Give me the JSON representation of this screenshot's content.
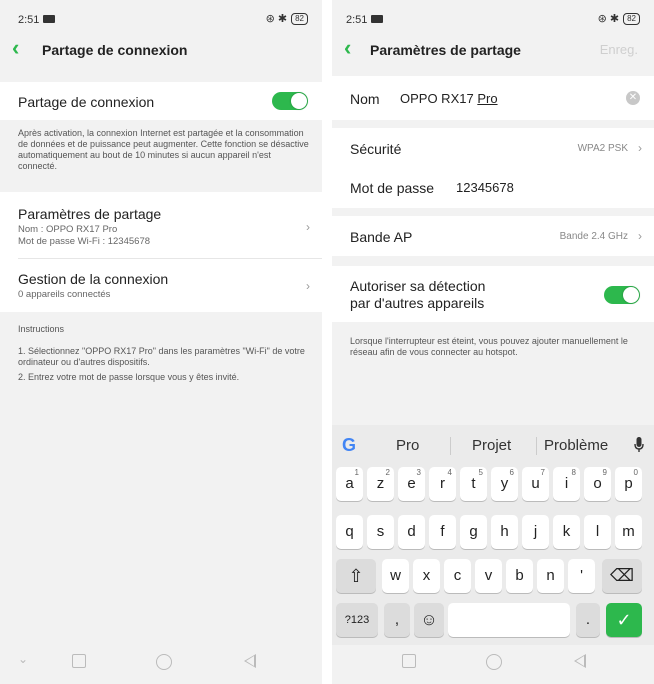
{
  "left": {
    "status": {
      "time": "2:51",
      "battery": "82",
      "icons": "⊛ ✱"
    },
    "title": "Partage de connexion",
    "hotspot": {
      "label": "Partage de connexion",
      "enabled": true
    },
    "hotspot_note": "Après activation, la connexion Internet est partagée et la consommation de données et de puissance peut augmenter. Cette fonction se désactive automatiquement au bout de 10 minutes si aucun appareil n'est connecté.",
    "settings": {
      "label": "Paramètres de partage",
      "sub1": "Nom : OPPO RX17 Pro",
      "sub2": "Mot de passe Wi-Fi : 12345678"
    },
    "connections": {
      "label": "Gestion de la connexion",
      "sub": "0 appareils connectés"
    },
    "instructions": {
      "heading": "Instructions",
      "step1": "1. Sélectionnez \"OPPO RX17 Pro\" dans les paramètres \"Wi-Fi\" de votre ordinateur ou d'autres dispositifs.",
      "step2": "2. Entrez votre mot de passe lorsque vous y êtes invité."
    }
  },
  "right": {
    "status": {
      "time": "2:51",
      "battery": "82",
      "icons": "⊛ ✱"
    },
    "title": "Paramètres de partage",
    "save_label": "Enreg.",
    "name": {
      "label": "Nom",
      "value_prefix": "OPPO RX17 ",
      "value_underlined": "Pro"
    },
    "security": {
      "label": "Sécurité",
      "value": "WPA2 PSK"
    },
    "password": {
      "label": "Mot de passe",
      "value": "12345678"
    },
    "band": {
      "label": "Bande AP",
      "value": "Bande 2.4 GHz"
    },
    "discover": {
      "line1": "Autoriser sa détection",
      "line2": "par d'autres appareils",
      "enabled": true
    },
    "discover_note": "Lorsque l'interrupteur est éteint, vous pouvez ajouter manuellement le réseau afin de vous connecter au hotspot."
  },
  "keyboard": {
    "google": "G",
    "suggestions": [
      "Pro",
      "Projet",
      "Problème"
    ],
    "row1": [
      "a",
      "z",
      "e",
      "r",
      "t",
      "y",
      "u",
      "i",
      "o",
      "p"
    ],
    "row1_nums": [
      "1",
      "2",
      "3",
      "4",
      "5",
      "6",
      "7",
      "8",
      "9",
      "0"
    ],
    "row2": [
      "q",
      "s",
      "d",
      "f",
      "g",
      "h",
      "j",
      "k",
      "l",
      "m"
    ],
    "row3": [
      "w",
      "x",
      "c",
      "v",
      "b",
      "n",
      "'"
    ],
    "symbols_key": "?123",
    "comma_key": ",",
    "period_key": ".",
    "shift": "⇧",
    "backspace": "⌫",
    "emoji": "☺",
    "enter": "✓",
    "mic": "🎙"
  },
  "colors": {
    "accent": "#2db84d",
    "background": "#f2f2f2"
  }
}
